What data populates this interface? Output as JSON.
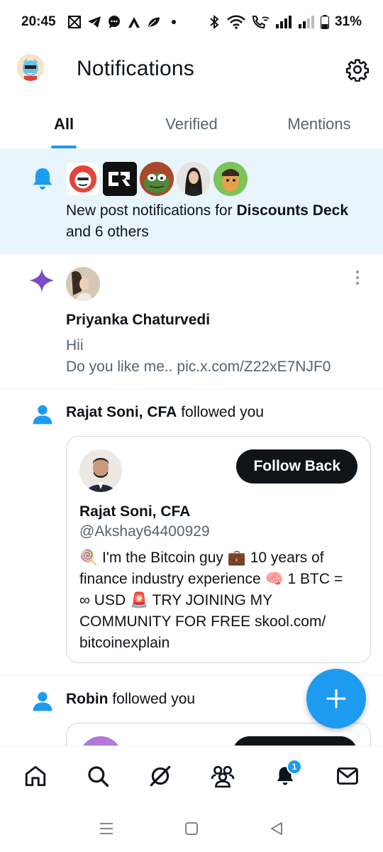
{
  "status_bar": {
    "time": "20:45",
    "battery": "31%",
    "left_icons": [
      "grid-app-icon",
      "telegram-icon",
      "message-icon",
      "a-app-icon",
      "leaf-icon",
      "dot-icon"
    ],
    "right_icons": [
      "bluetooth-icon",
      "wifi-icon",
      "wifi-call-icon",
      "signal-icon",
      "signal-2-icon",
      "battery-icon"
    ]
  },
  "header": {
    "title": "Notifications"
  },
  "tabs": [
    {
      "label": "All",
      "active": true
    },
    {
      "label": "Verified",
      "active": false
    },
    {
      "label": "Mentions",
      "active": false
    }
  ],
  "notifications": {
    "post_alert": {
      "text_prefix": "New post notifications for ",
      "name": "Discounts Deck",
      "text_suffix": " and 6 others"
    },
    "recommended": {
      "name": "Priyanka Chaturvedi",
      "line1": "Hii",
      "line2": "Do you like me.. pic.x.com/Z22xE7NJF0"
    },
    "follow_1": {
      "name": "Rajat Soni, CFA",
      "action": " followed you",
      "card": {
        "button": "Follow Back",
        "name": "Rajat Soni, CFA",
        "handle": "@Akshay64400929",
        "bio": "🍭 I'm the Bitcoin guy 💼 10 years of finance industry experience 🧠 1 BTC = ∞ USD 🚨 TRY JOINING MY COMMUNITY FOR FREE skool.com/ bitcoinexplain"
      }
    },
    "follow_2": {
      "name": "Robin",
      "action": " followed you"
    }
  },
  "bottom_nav": {
    "items": [
      "home-icon",
      "search-icon",
      "grok-icon",
      "communities-icon",
      "notifications-icon",
      "messages-icon"
    ],
    "badge": "1"
  },
  "colors": {
    "accent": "#1d9bf0",
    "highlight_bg": "#e8f5fd",
    "star": "#794bc4"
  }
}
